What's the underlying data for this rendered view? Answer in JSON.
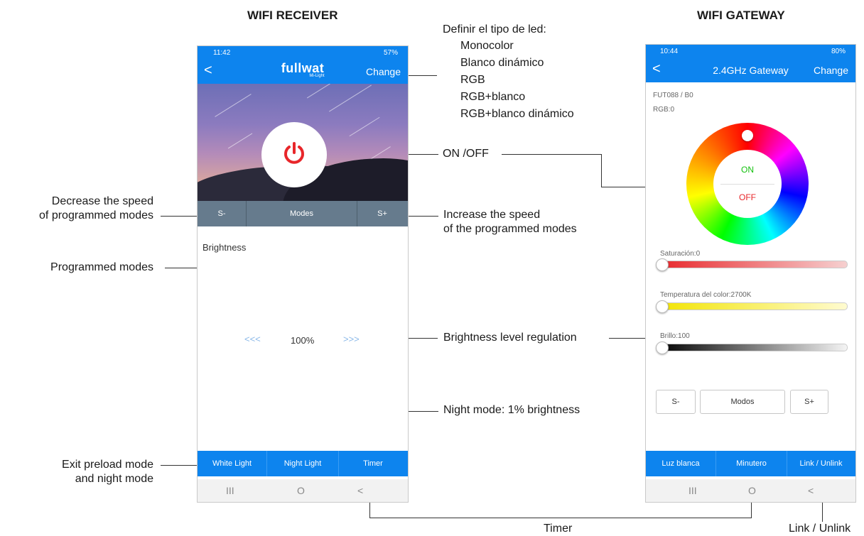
{
  "headings": {
    "receiver": "WIFI RECEIVER",
    "gateway": "WIFI GATEWAY"
  },
  "annotations": {
    "led_type_title": "Definir el tipo de led:",
    "led_types": [
      "Monocolor",
      "Blanco dinámico",
      "RGB",
      "RGB+blanco",
      "RGB+blanco dinámico"
    ],
    "on_off": "ON /OFF",
    "decrease_line1": "Decrease the speed",
    "decrease_line2": "of programmed modes",
    "increase_line1": "Increase the speed",
    "increase_line2": "of the programmed modes",
    "programmed_modes": "Programmed modes",
    "brightness_regulation": "Brightness level regulation",
    "night_mode": "Night mode: 1% brightness",
    "exit_line1": "Exit preload mode",
    "exit_line2": "and night mode",
    "timer": "Timer",
    "link_unlink": "Link / Unlink"
  },
  "receiver": {
    "status_time": "11:42",
    "status_right": "57%",
    "logo": "fullwat",
    "logo_sub": "Mi-Light",
    "back": "<",
    "change": "Change",
    "s_minus": "S-",
    "modes": "Modes",
    "s_plus": "S+",
    "brightness_label": "Brightness",
    "arrows_left": "<<<",
    "brightness_value": "100%",
    "arrows_right": ">>>",
    "white_light": "White Light",
    "night_light": "Night Light",
    "timer": "Timer",
    "nav": [
      "III",
      "O",
      "<"
    ]
  },
  "gateway": {
    "status_time": "10:44",
    "status_right": "80%",
    "back": "<",
    "title": "2.4GHz Gateway",
    "change": "Change",
    "device_id": "FUT088 / B0",
    "rgb": "RGB:0",
    "on": "ON",
    "off": "OFF",
    "saturation": "Saturación:0",
    "temperature": "Temperatura del color:2700K",
    "brightness": "Brillo:100",
    "s_minus": "S-",
    "modes": "Modos",
    "s_plus": "S+",
    "white_light": "Luz blanca",
    "timer": "Minutero",
    "link": "Link / Unlink",
    "nav": [
      "III",
      "O",
      "<"
    ]
  },
  "colors": {
    "accent": "#0d84ee",
    "modes_bar": "#667b8d",
    "power_red": "#e8262a"
  }
}
